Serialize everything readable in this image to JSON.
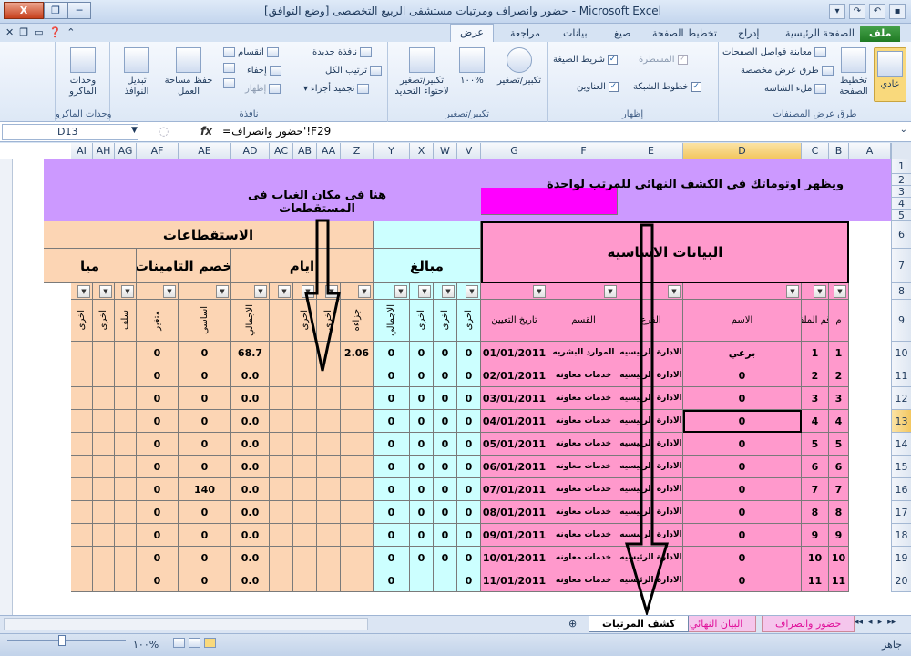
{
  "window": {
    "title": "حضور وانصراف ومرتبات مستشفى الربيع التخصصى  [وضع التوافق] - Microsoft Excel",
    "btn_close": "X",
    "btn_restore": "❐",
    "btn_min": "─"
  },
  "ribbon_tabs": [
    {
      "label": "ملف"
    },
    {
      "label": "الصفحة الرئيسية"
    },
    {
      "label": "إدراج"
    },
    {
      "label": "تخطيط الصفحة"
    },
    {
      "label": "صيغ"
    },
    {
      "label": "بيانات"
    },
    {
      "label": "مراجعة"
    },
    {
      "label": "عرض"
    }
  ],
  "ribbon": {
    "workbook_views": {
      "label": "طرق عرض المصنفات",
      "normal": "عادي",
      "page_layout": "تخطيط الصفحة",
      "page_break": "معاينة فواصل الصفحات",
      "custom_views": "طرق عرض مخصصة",
      "full_screen": "ملء الشاشة"
    },
    "show": {
      "label": "إظهار",
      "ruler": "المسطرة",
      "formula_bar": "شريط الصيغة",
      "gridlines": "خطوط الشبكة",
      "headings": "العناوين"
    },
    "zoom": {
      "label": "تكبير/تصغير",
      "zoom": "تكبير/تصغير",
      "hundred": "١٠٠%",
      "zoom_sel": "تكبير/تصغير لاحتواء التحديد"
    },
    "window": {
      "label": "نافذة",
      "new_window": "نافذة جديدة",
      "arrange_all": "ترتيب الكل",
      "freeze": "تجميد أجزاء",
      "split": "انقسام",
      "hide": "إخفاء",
      "unhide": "إظهار",
      "save_ws": "حفظ مساحة العمل",
      "switch": "تبديل النوافذ"
    },
    "macros": {
      "label": "وحدات الماكرو",
      "macros": "وحدات الماكرو"
    }
  },
  "formula_bar": {
    "name_box": "D13",
    "fx": "fx",
    "formula": "=حضور وانصراف'!F29"
  },
  "columns": [
    "A",
    "B",
    "C",
    "D",
    "E",
    "F",
    "G",
    "V",
    "W",
    "X",
    "Y",
    "Z",
    "AA",
    "AB",
    "AC",
    "AD",
    "AE",
    "AF",
    "AG",
    "AH",
    "AI"
  ],
  "rows": [
    "1",
    "2",
    "3",
    "4",
    "5",
    "6",
    "7",
    "8",
    "9",
    "10",
    "11",
    "12",
    "13",
    "14",
    "15",
    "16",
    "17",
    "18",
    "19",
    "20"
  ],
  "headers": {
    "basic_data": "البيانات الاساسيه",
    "deductions": "الاستقطاعات",
    "amounts": "مبالغ",
    "days": "ايام",
    "insurance": "خصم التامينات",
    "partial_cut": "ميا"
  },
  "subheaders": {
    "m": "م",
    "file_no": "رقم الملف",
    "name": "الاسم",
    "branch": "الفرع",
    "dept": "القسم",
    "hire_date": "تاريخ التعيين",
    "other1": "اخرى",
    "other2": "اخرى",
    "other3": "اخرى",
    "total_amt": "الاجمالي",
    "penalty": "جزاءه",
    "other4": "اخرى",
    "other5": "اخرى",
    "total_days": "الاجمالي",
    "basic": "اساسى",
    "variable": "متغير",
    "advance": "سلف",
    "other6": "اخرى",
    "other7": "اخرى"
  },
  "callouts": {
    "right": "ويظهر اوتوماتك فى الكشف النهائى للمرتب لواحدة",
    "left_line1": "هنا فى مكان الغياب فى",
    "left_line2": "المستقطعات"
  },
  "data_rows": [
    {
      "m": "1",
      "file": "1",
      "name": "برعي",
      "branch": "الادارة الرئيسيه",
      "dept": "الموارد البشريه",
      "date": "01/01/2011",
      "v": "0",
      "w": "0",
      "x": "0",
      "y": "0",
      "z": "2.06",
      "ad": "68.7",
      "ae": "0",
      "af": "0"
    },
    {
      "m": "2",
      "file": "2",
      "name": "0",
      "branch": "الادارة الرئيسيه",
      "dept": "خدمات معاونه",
      "date": "02/01/2011",
      "v": "0",
      "w": "0",
      "x": "0",
      "y": "0",
      "z": "",
      "ad": "0.0",
      "ae": "0",
      "af": "0"
    },
    {
      "m": "3",
      "file": "3",
      "name": "0",
      "branch": "الادارة الرئيسيه",
      "dept": "خدمات معاونه",
      "date": "03/01/2011",
      "v": "0",
      "w": "0",
      "x": "0",
      "y": "0",
      "z": "",
      "ad": "0.0",
      "ae": "0",
      "af": "0"
    },
    {
      "m": "4",
      "file": "4",
      "name": "0",
      "branch": "الادارة الرئيسيه",
      "dept": "خدمات معاونه",
      "date": "04/01/2011",
      "v": "0",
      "w": "0",
      "x": "0",
      "y": "0",
      "z": "",
      "ad": "0.0",
      "ae": "0",
      "af": "0"
    },
    {
      "m": "5",
      "file": "5",
      "name": "0",
      "branch": "الادارة الرئيسيه",
      "dept": "خدمات معاونه",
      "date": "05/01/2011",
      "v": "0",
      "w": "0",
      "x": "0",
      "y": "0",
      "z": "",
      "ad": "0.0",
      "ae": "0",
      "af": "0"
    },
    {
      "m": "6",
      "file": "6",
      "name": "0",
      "branch": "الادارة الرئيسيه",
      "dept": "خدمات معاونه",
      "date": "06/01/2011",
      "v": "0",
      "w": "0",
      "x": "0",
      "y": "0",
      "z": "",
      "ad": "0.0",
      "ae": "0",
      "af": "0"
    },
    {
      "m": "7",
      "file": "7",
      "name": "0",
      "branch": "الادارة الرئيسيه",
      "dept": "خدمات معاونه",
      "date": "07/01/2011",
      "v": "0",
      "w": "0",
      "x": "0",
      "y": "0",
      "z": "",
      "ad": "0.0",
      "ae": "140",
      "af": "0"
    },
    {
      "m": "8",
      "file": "8",
      "name": "0",
      "branch": "الادارة الرئيسيه",
      "dept": "خدمات معاونه",
      "date": "08/01/2011",
      "v": "0",
      "w": "0",
      "x": "0",
      "y": "0",
      "z": "",
      "ad": "0.0",
      "ae": "0",
      "af": "0"
    },
    {
      "m": "9",
      "file": "9",
      "name": "0",
      "branch": "الادارة الرئيسيه",
      "dept": "خدمات معاونه",
      "date": "09/01/2011",
      "v": "0",
      "w": "0",
      "x": "0",
      "y": "0",
      "z": "",
      "ad": "0.0",
      "ae": "0",
      "af": "0"
    },
    {
      "m": "10",
      "file": "10",
      "name": "0",
      "branch": "الادارة الرئيسيه",
      "dept": "خدمات معاونه",
      "date": "10/01/2011",
      "v": "0",
      "w": "0",
      "x": "0",
      "y": "0",
      "z": "",
      "ad": "0.0",
      "ae": "0",
      "af": "0"
    },
    {
      "m": "11",
      "file": "11",
      "name": "0",
      "branch": "الادارة الرئيسيه",
      "dept": "خدمات معاونه",
      "date": "11/01/2011",
      "v": "0",
      "w": "",
      "x": "",
      "y": "0",
      "z": "",
      "ad": "0.0",
      "ae": "0",
      "af": "0"
    }
  ],
  "sheet_tabs": {
    "active": "كشف المرتبات",
    "second": "البيان النهائي",
    "third": "حضور وانصراف"
  },
  "status": {
    "ready": "جاهز",
    "zoom": "١٠٠%"
  },
  "colors": {
    "purple": "#cc99ff",
    "orange": "#fcd5b4",
    "cyan": "#ccffff",
    "pink": "#ff99cc",
    "magenta": "#ff00ff"
  }
}
